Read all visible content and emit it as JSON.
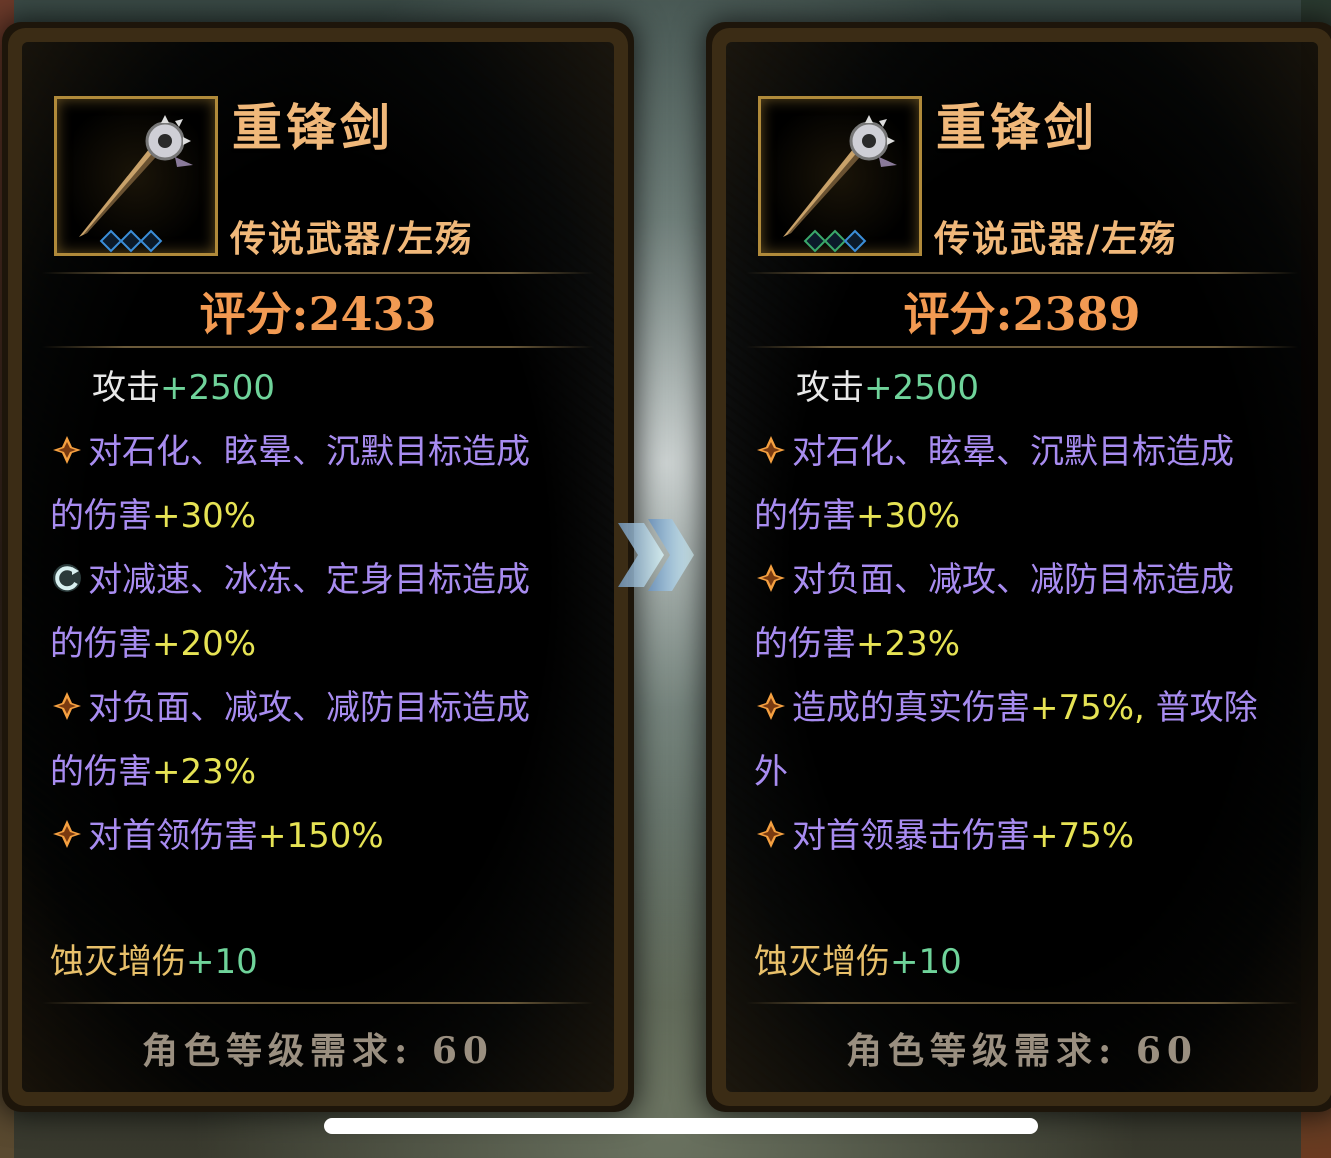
{
  "cards": {
    "left": {
      "name": "重锋剑",
      "type": "传说武器/左殇",
      "score_label": "评分:",
      "score_value": "2433",
      "attr_label": "攻击",
      "attr_value": "+2500",
      "effects": [
        {
          "icon": "spark-icon",
          "text": "对石化、眩晕、沉默目标造成",
          "text2": "的伤害",
          "value": "+30%"
        },
        {
          "icon": "swirl-icon",
          "text": "对减速、冰冻、定身目标造成",
          "text2": "的伤害",
          "value": "+20%"
        },
        {
          "icon": "spark-icon",
          "text": "对负面、减攻、减防目标造成",
          "text2": "的伤害",
          "value": "+23%"
        },
        {
          "icon": "spark-icon",
          "text": "对首领伤害",
          "text2": "",
          "value": "+150%"
        }
      ],
      "extra_label": "蚀灭增伤",
      "extra_value": "+10",
      "requirement": "角色等级需求: 60"
    },
    "right": {
      "name": "重锋剑",
      "type": "传说武器/左殇",
      "score_label": "评分:",
      "score_value": "2389",
      "attr_label": "攻击",
      "attr_value": "+2500",
      "effects": [
        {
          "icon": "spark-icon",
          "text": "对石化、眩晕、沉默目标造成",
          "text2": "的伤害",
          "value": "+30%"
        },
        {
          "icon": "spark-icon",
          "text": "对负面、减攻、减防目标造成",
          "text2": "的伤害",
          "value": "+23%"
        },
        {
          "icon": "spark-icon",
          "text": "造成的真实伤害",
          "value": "+75%,",
          "tail": "普攻除",
          "text2": "外"
        },
        {
          "icon": "spark-icon",
          "text": "对首领暴击伤害",
          "text2": "",
          "value": "+75%"
        }
      ],
      "extra_label": "蚀灭增伤",
      "extra_value": "+10",
      "requirement": "角色等级需求: 60"
    }
  },
  "colors": {
    "name": "#f0b87a",
    "score": "#f29a52",
    "effect_text": "#a88cf0",
    "effect_value": "#e6e354",
    "attr_value": "#6fd39a",
    "extra_label": "#e8c06a",
    "requirement": "#9a8f80"
  },
  "compare_arrow_icon": "double-chevron-right-icon"
}
